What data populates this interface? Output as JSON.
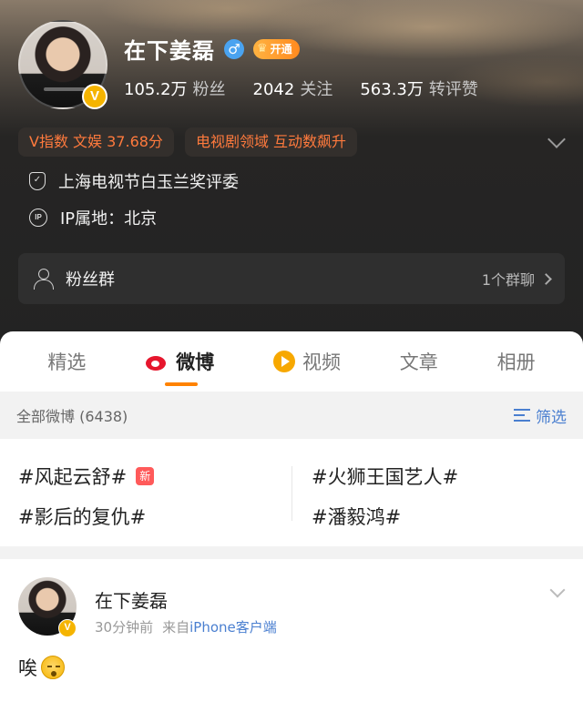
{
  "profile": {
    "name": "在下姜磊",
    "vip_label": "开通",
    "verified_mark": "V",
    "gender_symbol": "♂",
    "stats": [
      {
        "num": "105.2万",
        "label": "粉丝"
      },
      {
        "num": "2042",
        "label": "关注"
      },
      {
        "num": "563.3万",
        "label": "转评赞"
      }
    ],
    "chips": [
      "V指数 文娱 37.68分",
      "电视剧领域 互动数飙升"
    ],
    "info": [
      {
        "icon": "shield-icon",
        "text": "上海电视节白玉兰奖评委"
      },
      {
        "icon": "ip-icon",
        "icon_text": "IP",
        "text": "IP属地：北京"
      }
    ],
    "fans_group": {
      "label": "粉丝群",
      "count_text": "1个群聊"
    }
  },
  "tabs": [
    {
      "label": "精选",
      "active": false
    },
    {
      "label": "微博",
      "active": true,
      "icon": "weibo-logo-icon"
    },
    {
      "label": "视频",
      "active": false,
      "icon": "video-icon"
    },
    {
      "label": "文章",
      "active": false
    },
    {
      "label": "相册",
      "active": false
    }
  ],
  "filter_bar": {
    "all_label": "全部微博 (6438)",
    "filter_label": "筛选"
  },
  "topics": [
    {
      "text": "#风起云舒#",
      "badge": "新"
    },
    {
      "text": "#火狮王国艺人#"
    },
    {
      "text": "#影后的复仇#"
    },
    {
      "text": "#潘毅鸿#"
    }
  ],
  "post": {
    "author": "在下姜磊",
    "time": "30分钟前",
    "from_prefix": "来自",
    "source": "iPhone客户端",
    "text": "唉",
    "emoji": "sigh-emoji"
  },
  "colors": {
    "accent_orange": "#ff8200",
    "chip_text": "#ff7a3d",
    "link_blue": "#4a7fd0",
    "verified_gold": "#f5b400",
    "weibo_red": "#e6162d"
  }
}
